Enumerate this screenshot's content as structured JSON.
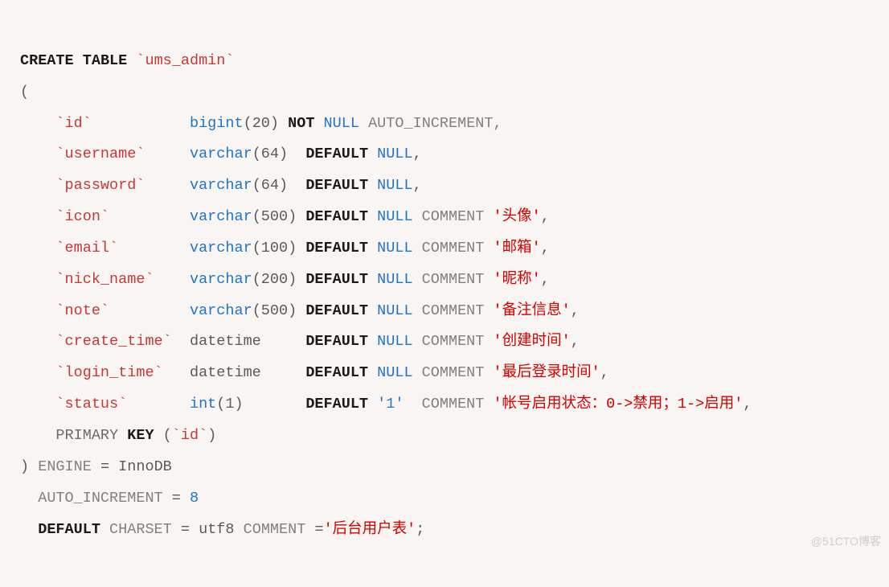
{
  "sql": {
    "create": "CREATE",
    "table": "TABLE",
    "table_name": "`ums_admin`",
    "open_paren": "(",
    "cols": [
      {
        "name": "`id`",
        "type": "bigint",
        "type_arg": "(20)",
        "not": "NOT",
        "null": "NULL",
        "extra": "AUTO_INCREMENT,",
        "has_default": false
      },
      {
        "name": "`username`",
        "type": "varchar",
        "type_arg": "(64)",
        "default": "DEFAULT",
        "null": "NULL",
        "tail_punct": ",",
        "has_default": true
      },
      {
        "name": "`password`",
        "type": "varchar",
        "type_arg": "(64)",
        "default": "DEFAULT",
        "null": "NULL",
        "tail_punct": ",",
        "has_default": true
      },
      {
        "name": "`icon`",
        "type": "varchar",
        "type_arg": "(500)",
        "default": "DEFAULT",
        "null": "NULL",
        "comment_kw": "COMMENT",
        "comment": "'头像'",
        "tail_punct": ",",
        "has_default": true
      },
      {
        "name": "`email`",
        "type": "varchar",
        "type_arg": "(100)",
        "default": "DEFAULT",
        "null": "NULL",
        "comment_kw": "COMMENT",
        "comment": "'邮箱'",
        "tail_punct": ",",
        "has_default": true
      },
      {
        "name": "`nick_name`",
        "type": "varchar",
        "type_arg": "(200)",
        "default": "DEFAULT",
        "null": "NULL",
        "comment_kw": "COMMENT",
        "comment": "'昵称'",
        "tail_punct": ",",
        "has_default": true
      },
      {
        "name": "`note`",
        "type": "varchar",
        "type_arg": "(500)",
        "default": "DEFAULT",
        "null": "NULL",
        "comment_kw": "COMMENT",
        "comment": "'备注信息'",
        "tail_punct": ",",
        "has_default": true
      },
      {
        "name": "`create_time`",
        "type_plain": "datetime",
        "default": "DEFAULT",
        "null": "NULL",
        "comment_kw": "COMMENT",
        "comment": "'创建时间'",
        "tail_punct": ",",
        "has_default": true
      },
      {
        "name": "`login_time`",
        "type_plain": "datetime",
        "default": "DEFAULT",
        "null": "NULL",
        "comment_kw": "COMMENT",
        "comment": "'最后登录时间'",
        "tail_punct": ",",
        "has_default": true
      },
      {
        "name": "`status`",
        "type": "int",
        "type_arg": "(1)",
        "default": "DEFAULT",
        "default_val": "'1'",
        "comment_kw": "COMMENT",
        "comment": "'帐号启用状态：0->禁用；1->启用'",
        "tail_punct": ",",
        "has_default": true
      }
    ],
    "primary": "PRIMARY",
    "key": "KEY",
    "pk_open": "(",
    "pk_col": "`id`",
    "pk_close": ")",
    "close_paren": ")",
    "engine": "ENGINE",
    "eq1": "=",
    "engine_val": "InnoDB",
    "auto_inc": "AUTO_INCREMENT",
    "eq2": "=",
    "auto_inc_val": "8",
    "default_kw": "DEFAULT",
    "charset": "CHARSET",
    "eq3": "=",
    "charset_val": "utf8",
    "comment_kw2": "COMMENT",
    "eq4": "=",
    "table_comment": "'后台用户表'",
    "semi": ";"
  },
  "watermark": "@51CTO博客"
}
